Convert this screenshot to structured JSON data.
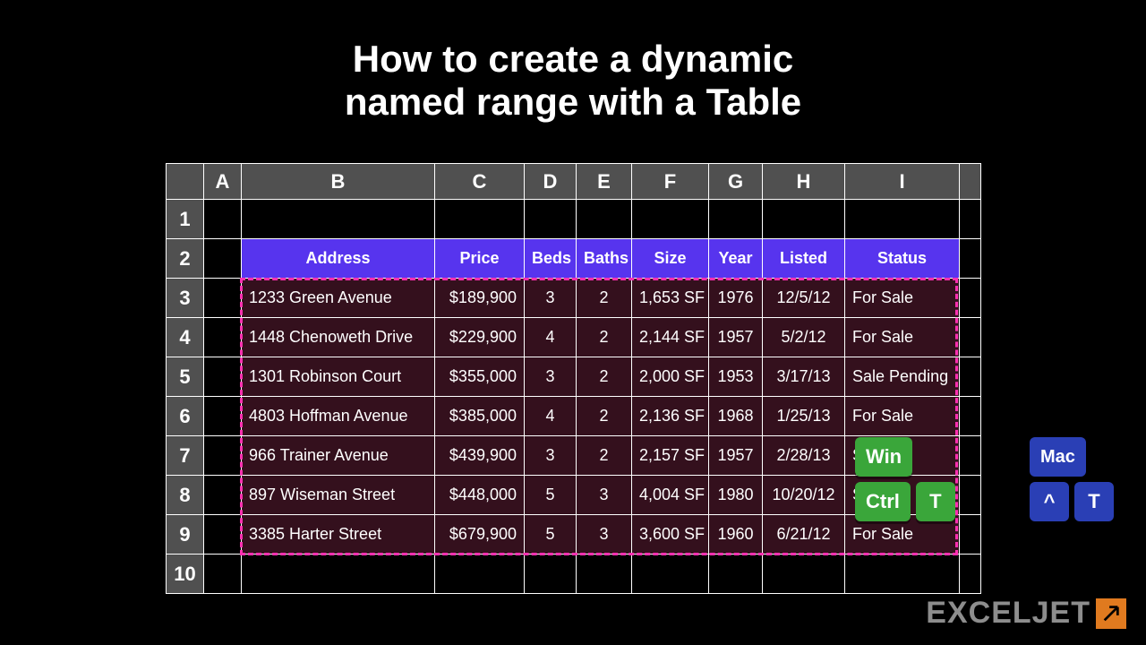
{
  "title_line1": "How to create a dynamic",
  "title_line2": "named range with a Table",
  "columns": [
    "A",
    "B",
    "C",
    "D",
    "E",
    "F",
    "G",
    "H",
    "I"
  ],
  "rows": [
    "1",
    "2",
    "3",
    "4",
    "5",
    "6",
    "7",
    "8",
    "9",
    "10"
  ],
  "table_headers": {
    "address": "Address",
    "price": "Price",
    "beds": "Beds",
    "baths": "Baths",
    "size": "Size",
    "year": "Year",
    "listed": "Listed",
    "status": "Status"
  },
  "data": [
    {
      "address": "1233 Green Avenue",
      "price": "$189,900",
      "beds": "3",
      "baths": "2",
      "size": "1,653 SF",
      "year": "1976",
      "listed": "12/5/12",
      "status": "For Sale"
    },
    {
      "address": "1448 Chenoweth Drive",
      "price": "$229,900",
      "beds": "4",
      "baths": "2",
      "size": "2,144 SF",
      "year": "1957",
      "listed": "5/2/12",
      "status": "For Sale"
    },
    {
      "address": "1301 Robinson Court",
      "price": "$355,000",
      "beds": "3",
      "baths": "2",
      "size": "2,000 SF",
      "year": "1953",
      "listed": "3/17/13",
      "status": "Sale Pending"
    },
    {
      "address": "4803 Hoffman Avenue",
      "price": "$385,000",
      "beds": "4",
      "baths": "2",
      "size": "2,136 SF",
      "year": "1968",
      "listed": "1/25/13",
      "status": "For Sale"
    },
    {
      "address": "966 Trainer Avenue",
      "price": "$439,900",
      "beds": "3",
      "baths": "2",
      "size": "2,157 SF",
      "year": "1957",
      "listed": "2/28/13",
      "status": "Sold"
    },
    {
      "address": "897 Wiseman Street",
      "price": "$448,000",
      "beds": "5",
      "baths": "3",
      "size": "4,004 SF",
      "year": "1980",
      "listed": "10/20/12",
      "status": "Sold"
    },
    {
      "address": "3385 Harter Street",
      "price": "$679,900",
      "beds": "5",
      "baths": "3",
      "size": "3,600 SF",
      "year": "1960",
      "listed": "6/21/12",
      "status": "For Sale"
    }
  ],
  "shortcuts": {
    "win": {
      "os": "Win",
      "keys": [
        "Ctrl",
        "T"
      ]
    },
    "mac": {
      "os": "Mac",
      "keys": [
        "^",
        "T"
      ]
    }
  },
  "logo_text": "EXCELJET"
}
